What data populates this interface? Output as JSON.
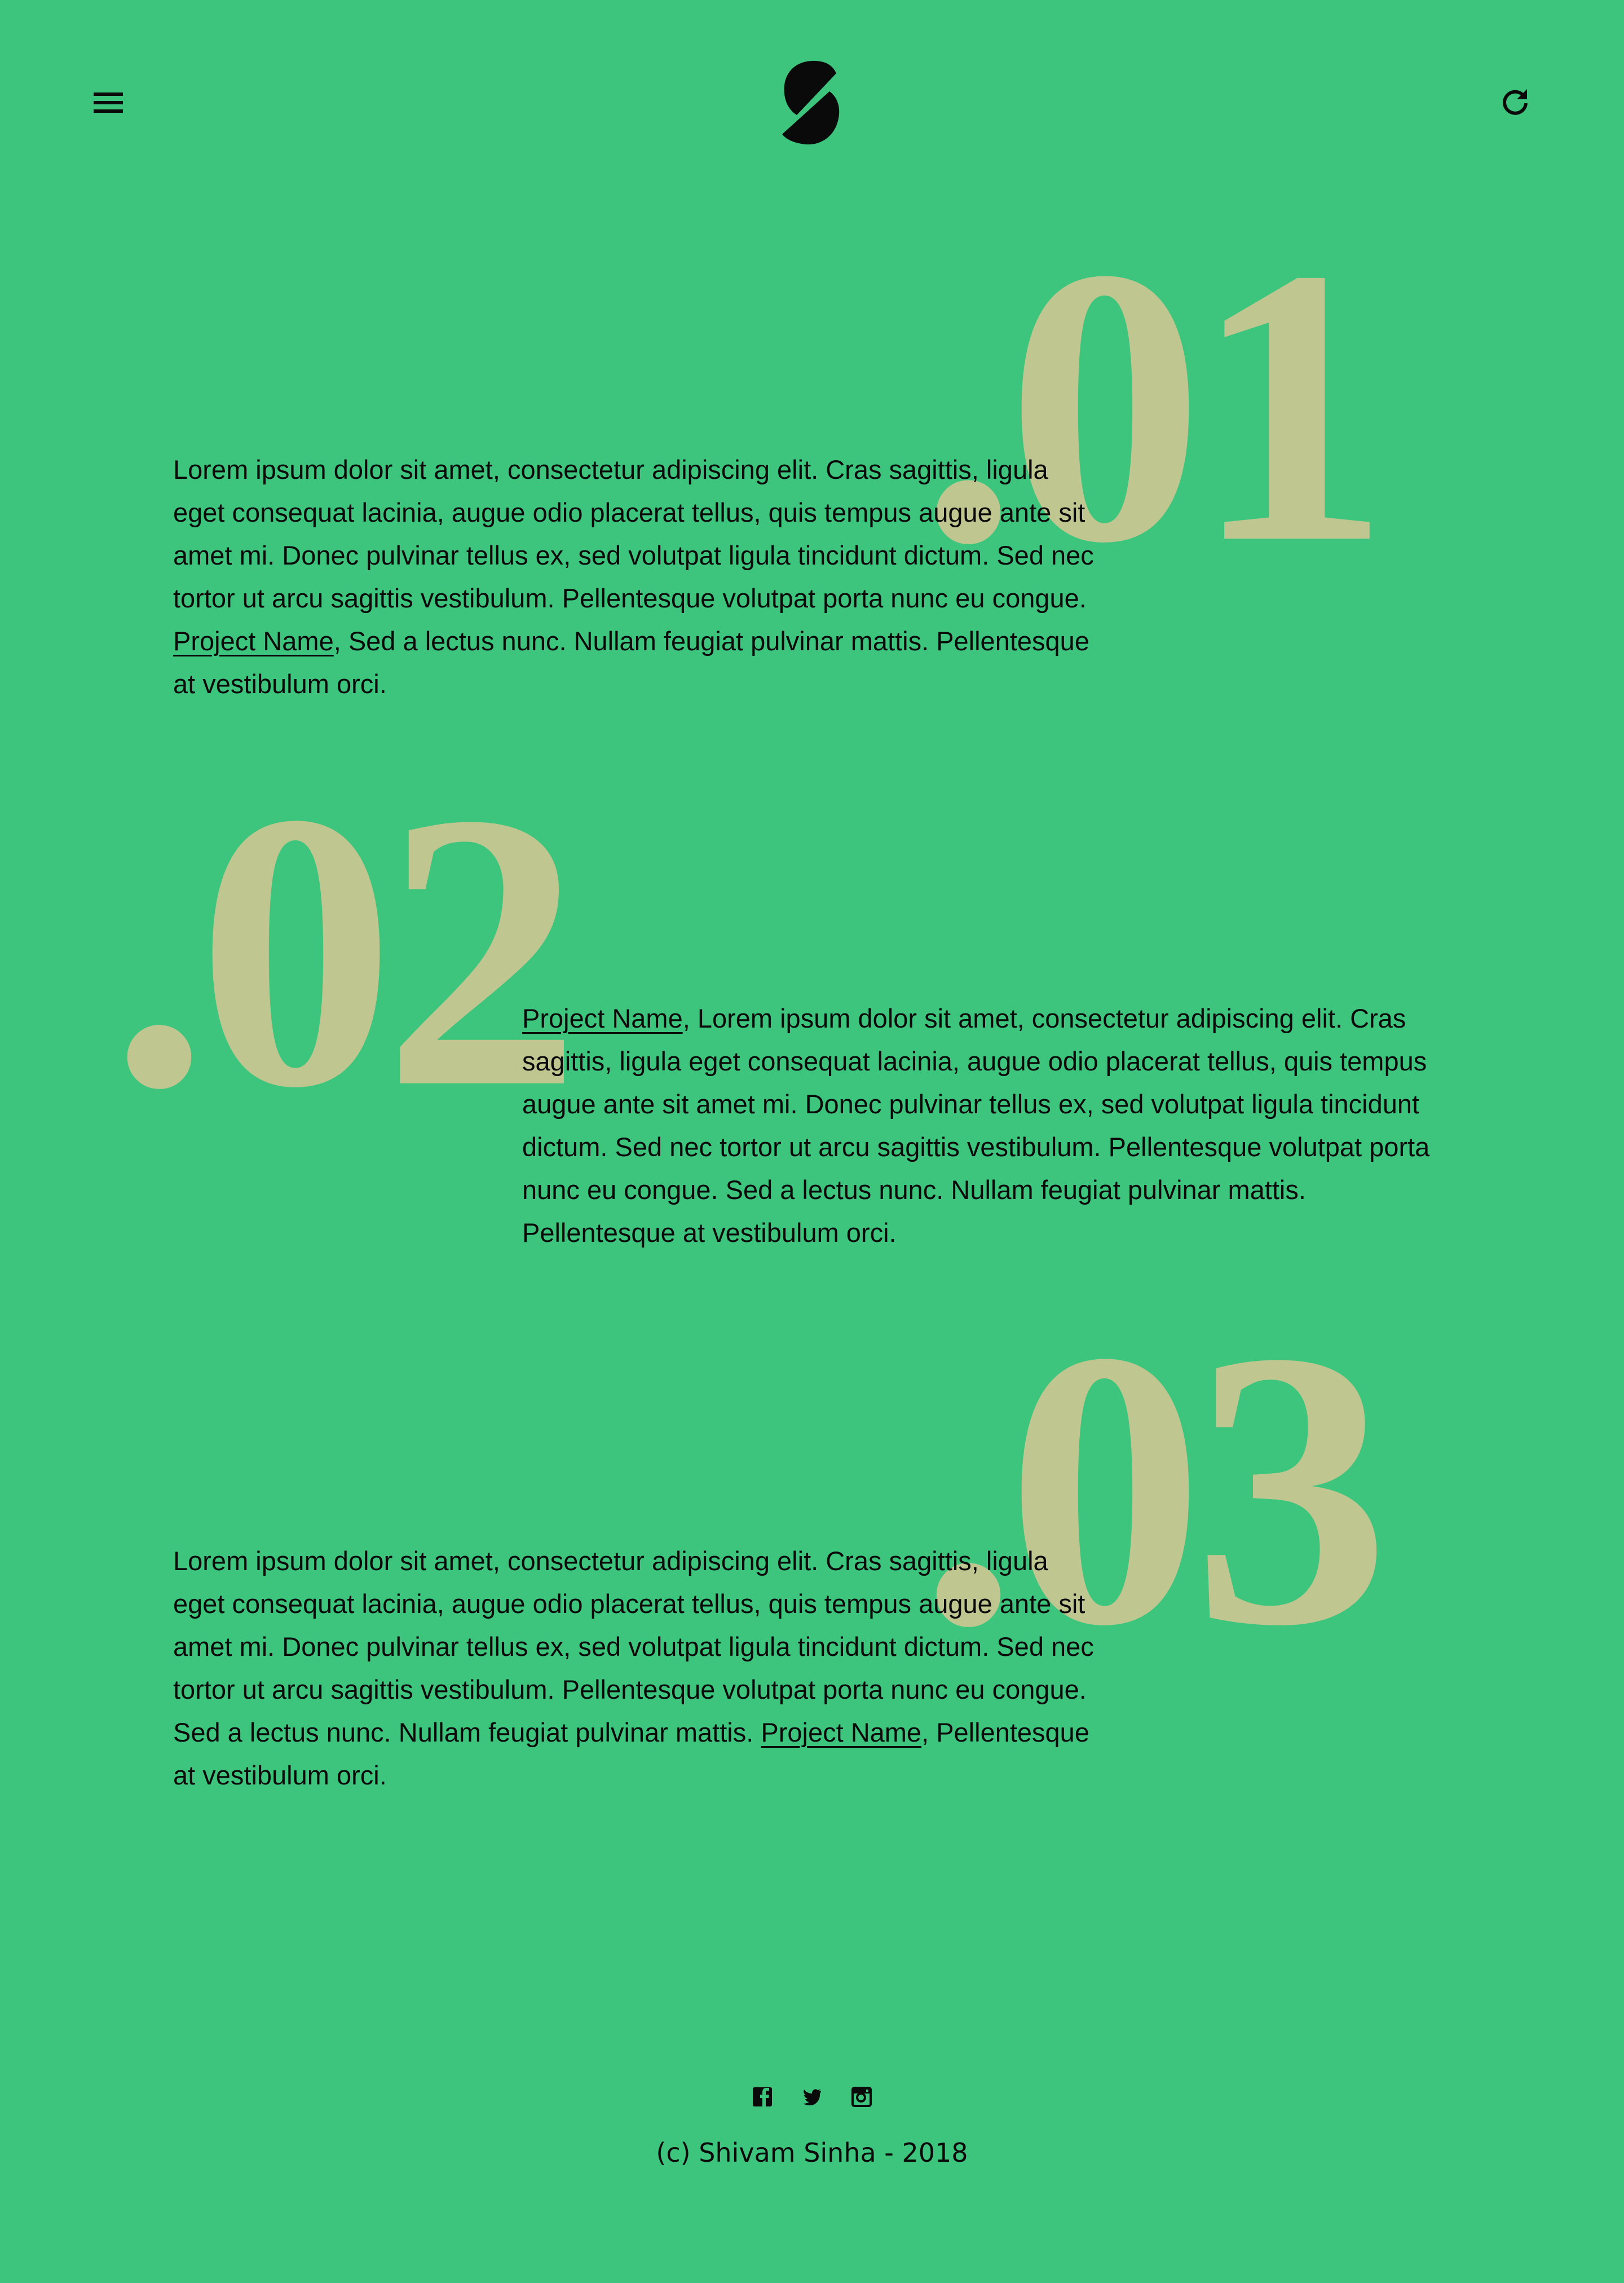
{
  "header": {
    "menu_icon": "hamburger-menu-icon",
    "logo_icon": "s-logo",
    "refresh_icon": "refresh-icon"
  },
  "colors": {
    "background": "#3dc57d",
    "numeral": "#bfc690",
    "text": "#0a0a0a"
  },
  "sections": [
    {
      "number": ".01",
      "before": "Lorem ipsum dolor sit amet, consectetur adipiscing elit. Cras sagittis, ligula eget consequat lacinia, augue odio placerat tellus, quis tempus augue ante sit amet mi. Donec pulvinar tellus ex, sed volutpat ligula tincidunt dictum. Sed nec tortor ut arcu sagittis vestibulum. Pellentesque volutpat porta nunc eu congue. ",
      "link": "Project Name",
      "after": ", Sed a lectus nunc. Nullam feugiat pulvinar mattis. Pellentesque at vestibulum orci."
    },
    {
      "number": ".02",
      "before": "",
      "link": "Project Name",
      "after": ", Lorem ipsum dolor sit amet, consectetur adipiscing elit. Cras sagittis, ligula eget consequat lacinia, augue odio placerat tellus, quis tempus augue ante sit amet mi. Donec pulvinar tellus ex, sed volutpat ligula tincidunt dictum. Sed nec tortor ut arcu sagittis vestibulum. Pellentesque volutpat porta nunc eu congue. Sed a lectus nunc. Nullam feugiat pulvinar mattis. Pellentesque at vestibulum orci."
    },
    {
      "number": ".03",
      "before": "Lorem ipsum dolor sit amet, consectetur adipiscing elit. Cras sagittis, ligula eget consequat lacinia, augue odio placerat tellus, quis tempus augue ante sit amet mi. Donec pulvinar tellus ex, sed volutpat ligula tincidunt dictum. Sed nec tortor ut arcu sagittis vestibulum. Pellentesque volutpat porta nunc eu congue. Sed a lectus nunc. Nullam feugiat pulvinar mattis. ",
      "link": "Project Name",
      "after": ", Pellentesque at vestibulum orci."
    }
  ],
  "footer": {
    "social_icons": [
      "facebook-icon",
      "twitter-icon",
      "instagram-icon"
    ],
    "copyright": "(c) Shivam Sinha - 2018"
  }
}
